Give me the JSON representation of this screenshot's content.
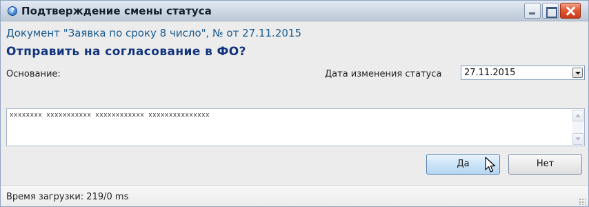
{
  "window": {
    "title": "Подтверждение смены статуса",
    "icon": "info-icon"
  },
  "document_line": "Документ \"Заявка по сроку 8 число\", № от 27.11.2015",
  "question": "Отправить на согласование в ФО?",
  "reason": {
    "label": "Основание:",
    "value": "xxxxxxxx  xxxxxxxxxxx  xxxxxxxxxxxx   xxxxxxxxxxxxxxx"
  },
  "status_date": {
    "label": "Дата изменения статуса",
    "value": "27.11.2015"
  },
  "buttons": {
    "yes": "Да",
    "no": "Нет"
  },
  "status_bar": {
    "text": "Время загрузки: 219/0 ms"
  },
  "colors": {
    "document_line": "#1b5a8e",
    "question": "#12347c",
    "close_button": "#e25a37"
  }
}
